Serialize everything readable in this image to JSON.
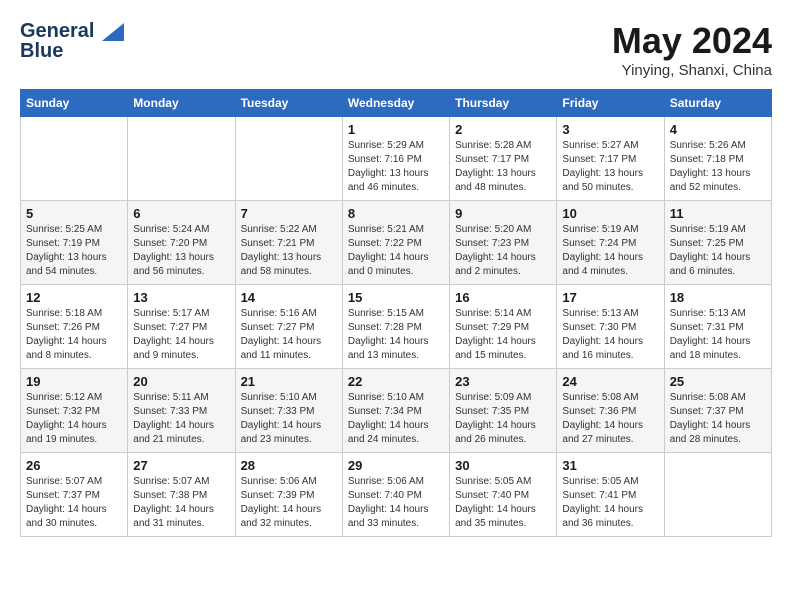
{
  "logo": {
    "line1": "General",
    "line2": "Blue"
  },
  "title": "May 2024",
  "location": "Yinying, Shanxi, China",
  "weekdays": [
    "Sunday",
    "Monday",
    "Tuesday",
    "Wednesday",
    "Thursday",
    "Friday",
    "Saturday"
  ],
  "weeks": [
    [
      {
        "day": "",
        "sunrise": "",
        "sunset": "",
        "daylight": ""
      },
      {
        "day": "",
        "sunrise": "",
        "sunset": "",
        "daylight": ""
      },
      {
        "day": "",
        "sunrise": "",
        "sunset": "",
        "daylight": ""
      },
      {
        "day": "1",
        "sunrise": "Sunrise: 5:29 AM",
        "sunset": "Sunset: 7:16 PM",
        "daylight": "Daylight: 13 hours and 46 minutes."
      },
      {
        "day": "2",
        "sunrise": "Sunrise: 5:28 AM",
        "sunset": "Sunset: 7:17 PM",
        "daylight": "Daylight: 13 hours and 48 minutes."
      },
      {
        "day": "3",
        "sunrise": "Sunrise: 5:27 AM",
        "sunset": "Sunset: 7:17 PM",
        "daylight": "Daylight: 13 hours and 50 minutes."
      },
      {
        "day": "4",
        "sunrise": "Sunrise: 5:26 AM",
        "sunset": "Sunset: 7:18 PM",
        "daylight": "Daylight: 13 hours and 52 minutes."
      }
    ],
    [
      {
        "day": "5",
        "sunrise": "Sunrise: 5:25 AM",
        "sunset": "Sunset: 7:19 PM",
        "daylight": "Daylight: 13 hours and 54 minutes."
      },
      {
        "day": "6",
        "sunrise": "Sunrise: 5:24 AM",
        "sunset": "Sunset: 7:20 PM",
        "daylight": "Daylight: 13 hours and 56 minutes."
      },
      {
        "day": "7",
        "sunrise": "Sunrise: 5:22 AM",
        "sunset": "Sunset: 7:21 PM",
        "daylight": "Daylight: 13 hours and 58 minutes."
      },
      {
        "day": "8",
        "sunrise": "Sunrise: 5:21 AM",
        "sunset": "Sunset: 7:22 PM",
        "daylight": "Daylight: 14 hours and 0 minutes."
      },
      {
        "day": "9",
        "sunrise": "Sunrise: 5:20 AM",
        "sunset": "Sunset: 7:23 PM",
        "daylight": "Daylight: 14 hours and 2 minutes."
      },
      {
        "day": "10",
        "sunrise": "Sunrise: 5:19 AM",
        "sunset": "Sunset: 7:24 PM",
        "daylight": "Daylight: 14 hours and 4 minutes."
      },
      {
        "day": "11",
        "sunrise": "Sunrise: 5:19 AM",
        "sunset": "Sunset: 7:25 PM",
        "daylight": "Daylight: 14 hours and 6 minutes."
      }
    ],
    [
      {
        "day": "12",
        "sunrise": "Sunrise: 5:18 AM",
        "sunset": "Sunset: 7:26 PM",
        "daylight": "Daylight: 14 hours and 8 minutes."
      },
      {
        "day": "13",
        "sunrise": "Sunrise: 5:17 AM",
        "sunset": "Sunset: 7:27 PM",
        "daylight": "Daylight: 14 hours and 9 minutes."
      },
      {
        "day": "14",
        "sunrise": "Sunrise: 5:16 AM",
        "sunset": "Sunset: 7:27 PM",
        "daylight": "Daylight: 14 hours and 11 minutes."
      },
      {
        "day": "15",
        "sunrise": "Sunrise: 5:15 AM",
        "sunset": "Sunset: 7:28 PM",
        "daylight": "Daylight: 14 hours and 13 minutes."
      },
      {
        "day": "16",
        "sunrise": "Sunrise: 5:14 AM",
        "sunset": "Sunset: 7:29 PM",
        "daylight": "Daylight: 14 hours and 15 minutes."
      },
      {
        "day": "17",
        "sunrise": "Sunrise: 5:13 AM",
        "sunset": "Sunset: 7:30 PM",
        "daylight": "Daylight: 14 hours and 16 minutes."
      },
      {
        "day": "18",
        "sunrise": "Sunrise: 5:13 AM",
        "sunset": "Sunset: 7:31 PM",
        "daylight": "Daylight: 14 hours and 18 minutes."
      }
    ],
    [
      {
        "day": "19",
        "sunrise": "Sunrise: 5:12 AM",
        "sunset": "Sunset: 7:32 PM",
        "daylight": "Daylight: 14 hours and 19 minutes."
      },
      {
        "day": "20",
        "sunrise": "Sunrise: 5:11 AM",
        "sunset": "Sunset: 7:33 PM",
        "daylight": "Daylight: 14 hours and 21 minutes."
      },
      {
        "day": "21",
        "sunrise": "Sunrise: 5:10 AM",
        "sunset": "Sunset: 7:33 PM",
        "daylight": "Daylight: 14 hours and 23 minutes."
      },
      {
        "day": "22",
        "sunrise": "Sunrise: 5:10 AM",
        "sunset": "Sunset: 7:34 PM",
        "daylight": "Daylight: 14 hours and 24 minutes."
      },
      {
        "day": "23",
        "sunrise": "Sunrise: 5:09 AM",
        "sunset": "Sunset: 7:35 PM",
        "daylight": "Daylight: 14 hours and 26 minutes."
      },
      {
        "day": "24",
        "sunrise": "Sunrise: 5:08 AM",
        "sunset": "Sunset: 7:36 PM",
        "daylight": "Daylight: 14 hours and 27 minutes."
      },
      {
        "day": "25",
        "sunrise": "Sunrise: 5:08 AM",
        "sunset": "Sunset: 7:37 PM",
        "daylight": "Daylight: 14 hours and 28 minutes."
      }
    ],
    [
      {
        "day": "26",
        "sunrise": "Sunrise: 5:07 AM",
        "sunset": "Sunset: 7:37 PM",
        "daylight": "Daylight: 14 hours and 30 minutes."
      },
      {
        "day": "27",
        "sunrise": "Sunrise: 5:07 AM",
        "sunset": "Sunset: 7:38 PM",
        "daylight": "Daylight: 14 hours and 31 minutes."
      },
      {
        "day": "28",
        "sunrise": "Sunrise: 5:06 AM",
        "sunset": "Sunset: 7:39 PM",
        "daylight": "Daylight: 14 hours and 32 minutes."
      },
      {
        "day": "29",
        "sunrise": "Sunrise: 5:06 AM",
        "sunset": "Sunset: 7:40 PM",
        "daylight": "Daylight: 14 hours and 33 minutes."
      },
      {
        "day": "30",
        "sunrise": "Sunrise: 5:05 AM",
        "sunset": "Sunset: 7:40 PM",
        "daylight": "Daylight: 14 hours and 35 minutes."
      },
      {
        "day": "31",
        "sunrise": "Sunrise: 5:05 AM",
        "sunset": "Sunset: 7:41 PM",
        "daylight": "Daylight: 14 hours and 36 minutes."
      },
      {
        "day": "",
        "sunrise": "",
        "sunset": "",
        "daylight": ""
      }
    ]
  ]
}
